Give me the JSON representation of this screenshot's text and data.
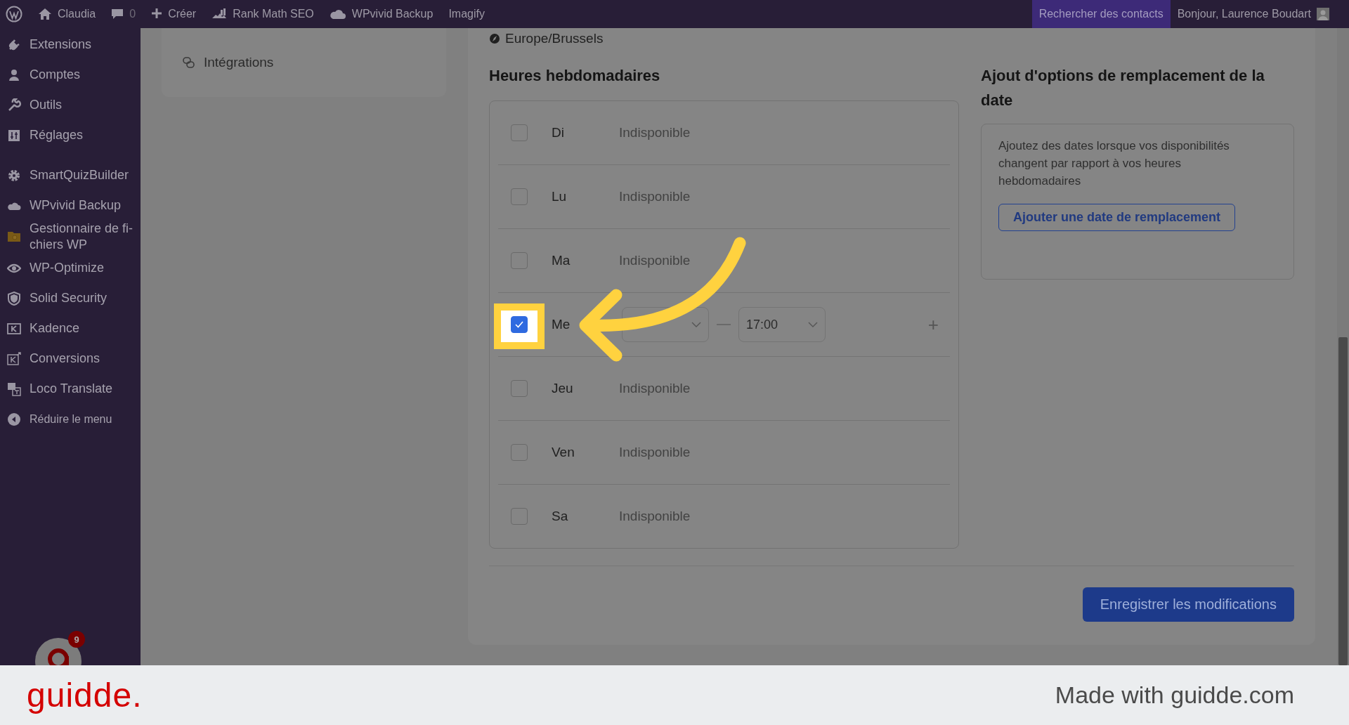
{
  "admin_bar": {
    "site": "Claudia",
    "comments": "0",
    "items": [
      "Créer",
      "Rank Math SEO",
      "WPvivid Backup",
      "Imagify"
    ],
    "search_contacts": "Rechercher des contacts",
    "greeting": "Bonjour, Laurence Boudart"
  },
  "sidebar": {
    "items": [
      {
        "label": "Extensions"
      },
      {
        "label": "Comptes"
      },
      {
        "label": "Outils"
      },
      {
        "label": "Réglages"
      },
      {
        "label": "SmartQuizBuilder"
      },
      {
        "label": "WPvivid Backup"
      },
      {
        "label": "Gestionnaire de fi-chiers WP"
      },
      {
        "label": "WP-Optimize"
      },
      {
        "label": "Solid Security"
      },
      {
        "label": "Kadence"
      },
      {
        "label": "Conversions"
      },
      {
        "label": "Loco Translate"
      }
    ],
    "collapse": "Réduire le menu",
    "notification_badge": "9"
  },
  "settings_nav": {
    "items": [
      {
        "label": "Intégrations"
      }
    ]
  },
  "timezone": "Europe/Brussels",
  "weekly_hours": {
    "title": "Heures hebdomadaires",
    "days": [
      {
        "label": "Di",
        "checked": false,
        "highlighted": false,
        "status": "Indisponible"
      },
      {
        "label": "Lu",
        "checked": false,
        "highlighted": false,
        "status": "Indisponible"
      },
      {
        "label": "Ma",
        "checked": false,
        "highlighted": false,
        "status": "Indisponible"
      },
      {
        "label": "Me",
        "checked": true,
        "highlighted": true,
        "end": "17:00",
        "add": "+"
      },
      {
        "label": "Jeu",
        "checked": false,
        "highlighted": false,
        "status": "Indisponible"
      },
      {
        "label": "Ven",
        "checked": false,
        "highlighted": false,
        "status": "Indisponible"
      },
      {
        "label": "Sa",
        "checked": false,
        "highlighted": false,
        "status": "Indisponible"
      }
    ]
  },
  "overrides": {
    "title": "Ajout d'options de remplacement de la date",
    "text": "Ajoutez des dates lorsque vos disponibilités changent par rapport à vos heures hebdomadaires",
    "button": "Ajouter une date de remplacement"
  },
  "save_button": "Enregistrer les modifications",
  "footer": {
    "logo": "guidde.",
    "credit": "Made with guidde.com"
  }
}
